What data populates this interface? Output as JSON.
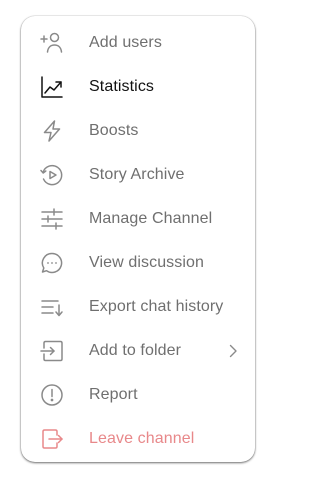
{
  "menu": {
    "items": [
      {
        "label": "Add users",
        "icon": "add-user-icon"
      },
      {
        "label": "Statistics",
        "icon": "statistics-icon"
      },
      {
        "label": "Boosts",
        "icon": "lightning-icon"
      },
      {
        "label": "Story Archive",
        "icon": "story-archive-icon"
      },
      {
        "label": "Manage Channel",
        "icon": "sliders-icon"
      },
      {
        "label": "View discussion",
        "icon": "chat-bubble-icon"
      },
      {
        "label": "Export chat history",
        "icon": "export-icon"
      },
      {
        "label": "Add to folder",
        "icon": "folder-icon"
      },
      {
        "label": "Report",
        "icon": "report-icon"
      },
      {
        "label": "Leave channel",
        "icon": "leave-icon"
      }
    ]
  },
  "colors": {
    "text": "#6f6f6f",
    "text_active": "#111111",
    "icon": "#8a8a8a",
    "danger": "#e8888a"
  }
}
